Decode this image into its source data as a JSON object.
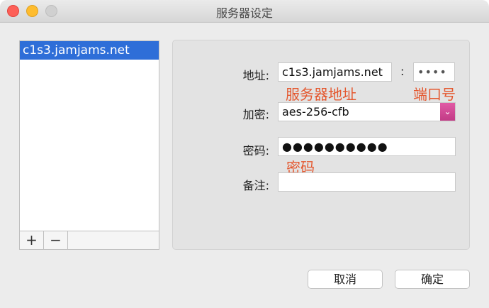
{
  "window": {
    "title": "服务器设定"
  },
  "server_list": {
    "items": [
      "c1s3.jamjams.net"
    ],
    "add_label": "+",
    "remove_label": "−"
  },
  "form": {
    "address_label": "地址:",
    "address_value": "c1s3.jamjams.net",
    "port_separator": ":",
    "port_value": "••••",
    "cipher_label": "加密:",
    "cipher_value": "aes-256-cfb",
    "cipher_arrow": "⌄",
    "password_label": "密码:",
    "password_value": "●●●●●●●●●●",
    "note_label": "备注:",
    "note_value": ""
  },
  "annotations": {
    "server_address": "服务器地址",
    "port": "端口号",
    "password": "密码"
  },
  "buttons": {
    "cancel": "取消",
    "confirm": "确定"
  },
  "colors": {
    "annotation": "#e4572e",
    "selection": "#2e6ed8",
    "select_accent": "#d04a95"
  }
}
